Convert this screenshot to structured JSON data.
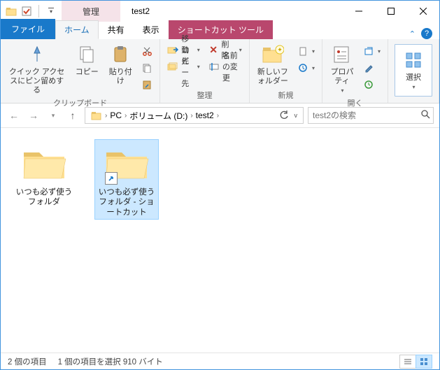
{
  "titlebar": {
    "contextual_label": "管理",
    "window_title": "test2"
  },
  "tabs": {
    "file": "ファイル",
    "home": "ホーム",
    "share": "共有",
    "view": "表示",
    "shortcut_tools": "ショートカット ツール"
  },
  "ribbon": {
    "clipboard": {
      "label": "クリップボード",
      "pin": "クイック アクセスにピン留めする",
      "copy": "コピー",
      "paste": "貼り付け"
    },
    "organize": {
      "label": "整理",
      "move_to": "移動先",
      "copy_to": "コピー先",
      "delete": "削除",
      "rename": "名前の変更"
    },
    "new": {
      "label": "新規",
      "new_folder": "新しいフォルダー"
    },
    "open": {
      "label": "開く",
      "properties": "プロパティ"
    },
    "select": {
      "label": "選択"
    }
  },
  "breadcrumb": {
    "pc": "PC",
    "volume": "ボリューム (D:)",
    "folder": "test2"
  },
  "search": {
    "placeholder": "test2の検索"
  },
  "items": [
    {
      "name": "いつも必ず使うフォルダ",
      "is_shortcut": false,
      "selected": false
    },
    {
      "name": "いつも必ず使うフォルダ - ショートカット",
      "is_shortcut": true,
      "selected": true
    }
  ],
  "status": {
    "count": "2 個の項目",
    "selection": "1 個の項目を選択 910 バイト"
  },
  "colors": {
    "folder_fill": "#ffe092",
    "folder_tab": "#e9c36a",
    "accent_blue": "#1979ca",
    "accent_pink": "#b9476d"
  }
}
